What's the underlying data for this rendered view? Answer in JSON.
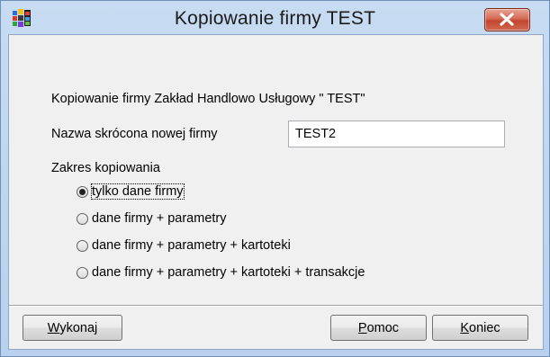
{
  "window": {
    "title": "Kopiowanie firmy TEST",
    "close_icon": "close-x-icon",
    "app_icon": "colorful-app-icon"
  },
  "dialog": {
    "info_text": "Kopiowanie firmy Zakład Handlowo Usługowy \" TEST\"",
    "short_name_label": "Nazwa skrócona nowej firmy",
    "short_name_value": "TEST2",
    "scope_label": "Zakres kopiowania",
    "options": [
      {
        "label": "tylko dane firmy",
        "selected": true
      },
      {
        "label": "dane firmy + parametry",
        "selected": false
      },
      {
        "label": "dane firmy + parametry + kartoteki",
        "selected": false
      },
      {
        "label": "dane firmy + parametry + kartoteki + transakcje",
        "selected": false
      }
    ]
  },
  "buttons": {
    "execute": {
      "accel": "W",
      "rest": "ykonaj"
    },
    "help": {
      "accel": "P",
      "rest": "omoc"
    },
    "close": {
      "accel": "K",
      "rest": "oniec"
    }
  }
}
